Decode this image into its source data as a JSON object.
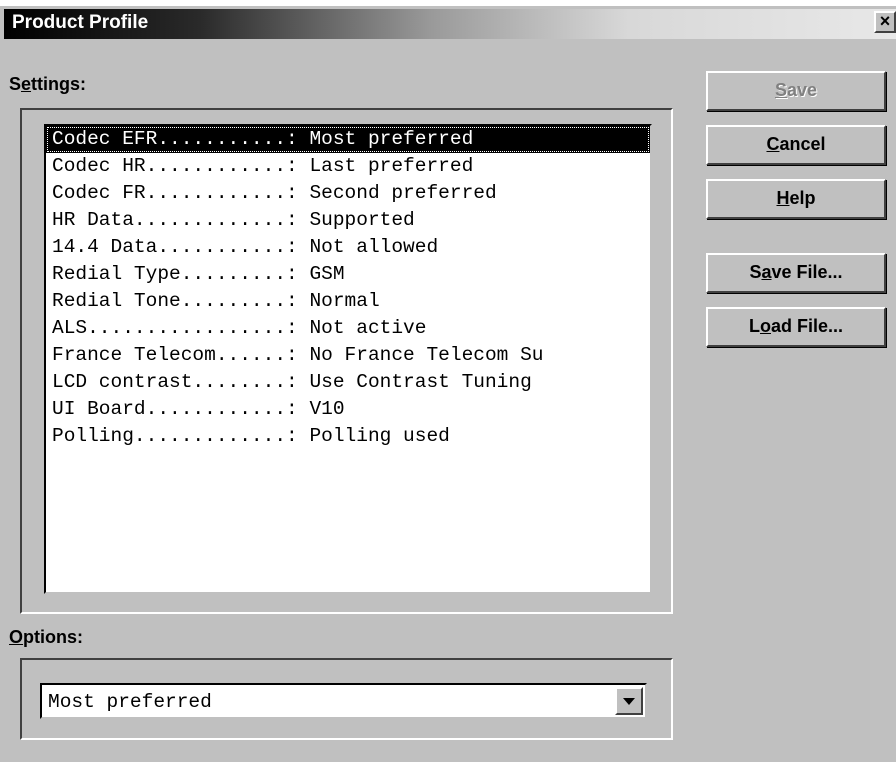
{
  "window": {
    "title": "Product Profile",
    "close_glyph": "×"
  },
  "settings": {
    "label_pre": "S",
    "label_mnemonic": "e",
    "label_post": "ttings:",
    "rows": [
      {
        "text": "Codec EFR...........: Most preferred",
        "selected": true
      },
      {
        "text": "Codec HR............: Last preferred",
        "selected": false
      },
      {
        "text": "Codec FR............: Second preferred",
        "selected": false
      },
      {
        "text": "HR Data.............: Supported",
        "selected": false
      },
      {
        "text": "14.4 Data...........: Not allowed",
        "selected": false
      },
      {
        "text": "Redial Type.........: GSM",
        "selected": false
      },
      {
        "text": "Redial Tone.........: Normal",
        "selected": false
      },
      {
        "text": "ALS.................: Not active",
        "selected": false
      },
      {
        "text": "France Telecom......: No France Telecom Su",
        "selected": false
      },
      {
        "text": "LCD contrast........: Use Contrast Tuning",
        "selected": false
      },
      {
        "text": "UI Board............: V10",
        "selected": false
      },
      {
        "text": "Polling.............: Polling used",
        "selected": false
      }
    ]
  },
  "options": {
    "label_mnemonic": "O",
    "label_post": "ptions:",
    "selected_value": "Most preferred"
  },
  "buttons": {
    "save": {
      "pre": "",
      "mnemonic": "S",
      "post": "ave",
      "disabled": true
    },
    "cancel": {
      "pre": "",
      "mnemonic": "C",
      "post": "ancel"
    },
    "help": {
      "pre": "",
      "mnemonic": "H",
      "post": "elp"
    },
    "save_file": {
      "pre": "S",
      "mnemonic": "a",
      "post": "ve File..."
    },
    "load_file": {
      "pre": "L",
      "mnemonic": "o",
      "post": "ad File..."
    }
  },
  "icons": {
    "close": "close-icon",
    "dropdown": "chevron-down-icon"
  }
}
